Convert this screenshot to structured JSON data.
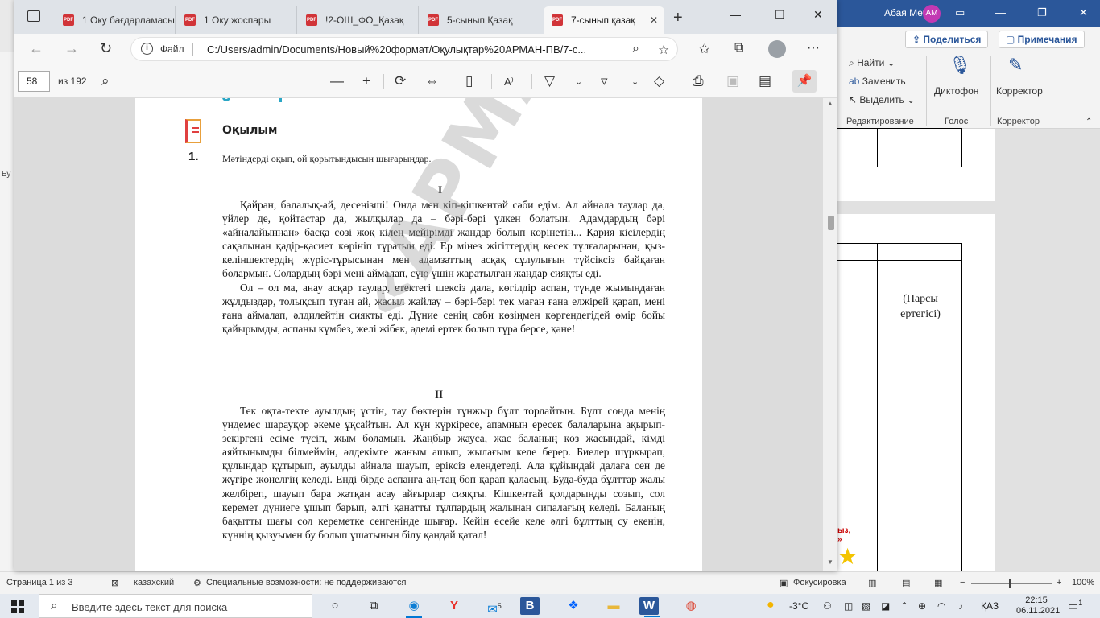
{
  "word": {
    "user_name": "Абая Мечта",
    "user_initials": "AM",
    "share_label": "Поделиться",
    "notes_label": "Примечания",
    "find_label": "Найти",
    "replace_label": "Заменить",
    "select_label": "Выделить",
    "dictaphone_label": "Диктофон",
    "corrector_label": "Корректор",
    "group_editing": "Редактирование",
    "group_voice": "Голос",
    "group_corrector": "Корректор",
    "left_label": "Бу",
    "table_text_line1": "(Парсы",
    "table_text_line2": "ертегісі)",
    "red_text_line1": "ыз,",
    "red_text_line2": "»",
    "status_page": "Страница 1 из 3",
    "status_language": "казахский",
    "status_accessibility": "Специальные возможности: не поддерживаются",
    "status_focus": "Фокусировка",
    "status_zoom": "100%",
    "zoom_minus": "−",
    "zoom_plus": "+"
  },
  "browser": {
    "tabs": [
      {
        "label": "1 Оку бағдарламасы",
        "active": false
      },
      {
        "label": "1 Оку жоспары",
        "active": false
      },
      {
        "label": "!2-ОШ_ФО_Қазақ",
        "active": false
      },
      {
        "label": "5-сынып Қазақ",
        "active": false
      },
      {
        "label": "7-сынып қазақ",
        "active": true
      }
    ],
    "tab_pdf_badge": "PDF",
    "address_label": "Файл",
    "url": "C:/Users/admin/Documents/Новый%20формат/Оқулықтар%20АРМАН-ПВ/7-с...",
    "pdf": {
      "current_page": "58",
      "page_of": "из 192"
    }
  },
  "document": {
    "section_title": "Оқылым",
    "task_number": "1.",
    "task_text": "Мәтіндерді оқып, ой қорытындысын шығарыңдар.",
    "part1_label": "I",
    "part1_paragraphs": [
      "Қайран, балалық-ай, десеңізші! Онда мен кіп-кішкентай сәби едім. Ал айнала таулар да, үйлер де, қойтастар да, жылқылар да – бәрі-бәрі үлкен болатын. Адамдардың бәрі «айналайыннан» басқа сөзі жоқ кілең мейірімді жандар болып көрінетін... Қария кісілердің сақалынан қадір-қасиет көрініп тұратын еді. Ер мінез жігіттердің кесек тұлғаларынан, қыз-келіншектердің жүріс-тұрысынан мен адамзаттың асқақ сұлулығын түйсіксіз байқаған болармын. Солардың бәрі мені аймалап, сүю үшін жаратылған жандар сияқты еді.",
      "Ол – ол ма, анау асқар таулар, етектегі шексіз дала, көгілдір аспан, түнде жымыңдаған жұлдыздар, толықсып туған ай, жасыл жайлау – бәрі-бәрі тек маған ғана елжірей қарап, мені ғана аймалап, әлдилейтін сияқты еді. Дүние сенің сәби көзіңмен көргендегідей өмір бойы қайырымды, аспаны күмбез, желі жібек, әдемі ертек болып тұра берсе, қәне!"
    ],
    "part2_label": "II",
    "part2_paragraphs": [
      "Тек оқта-текте ауылдың үстін, тау бөктерін тұнжыр бұлт торлайтын. Бұлт сонда менің үндемес шарауқор әкеме ұқсайтын. Ал күн күркіресе, апамның ересек балаларына ақырып-зекіргені есіме түсіп, жым боламын. Жаңбыр жауса, жас баланың көз жасындай, кімді аяйтынымды білмеймін, әлдекімге жаным ашып, жылағым келе берер. Биелер шұрқырап, құлындар құтырып, ауылды айнала шауып, еріксіз елендетеді. Ала құйындай далаға сен де жүгіре жөнелгің келеді. Енді бірде аспанға аң-таң боп қарап қаласың. Буда-буда бұлттар жалы желбіреп, шауып бара жатқан асау айғырлар сияқты. Кішкентай қолдарыңды созып, сол керемет дүниеге ұшып барып, әлгі қанатты тұлпардың жалынан сипалағың келеді. Баланың бақытты шағы сол кереметке сенгенінде шығар. Кейін есейе келе әлгі бұлттың су екенін, күннің қызуымен бу болып ұшатынын білу қандай қатал!"
    ],
    "watermark": "«АРМАН-ПВ баспасы»"
  },
  "taskbar": {
    "search_placeholder": "Введите здесь текст для поиска",
    "mail_badge": "5",
    "weather": "-3°C",
    "language": "ҚАЗ",
    "time": "22:15",
    "date": "06.11.2021",
    "notifications_count": "1"
  }
}
